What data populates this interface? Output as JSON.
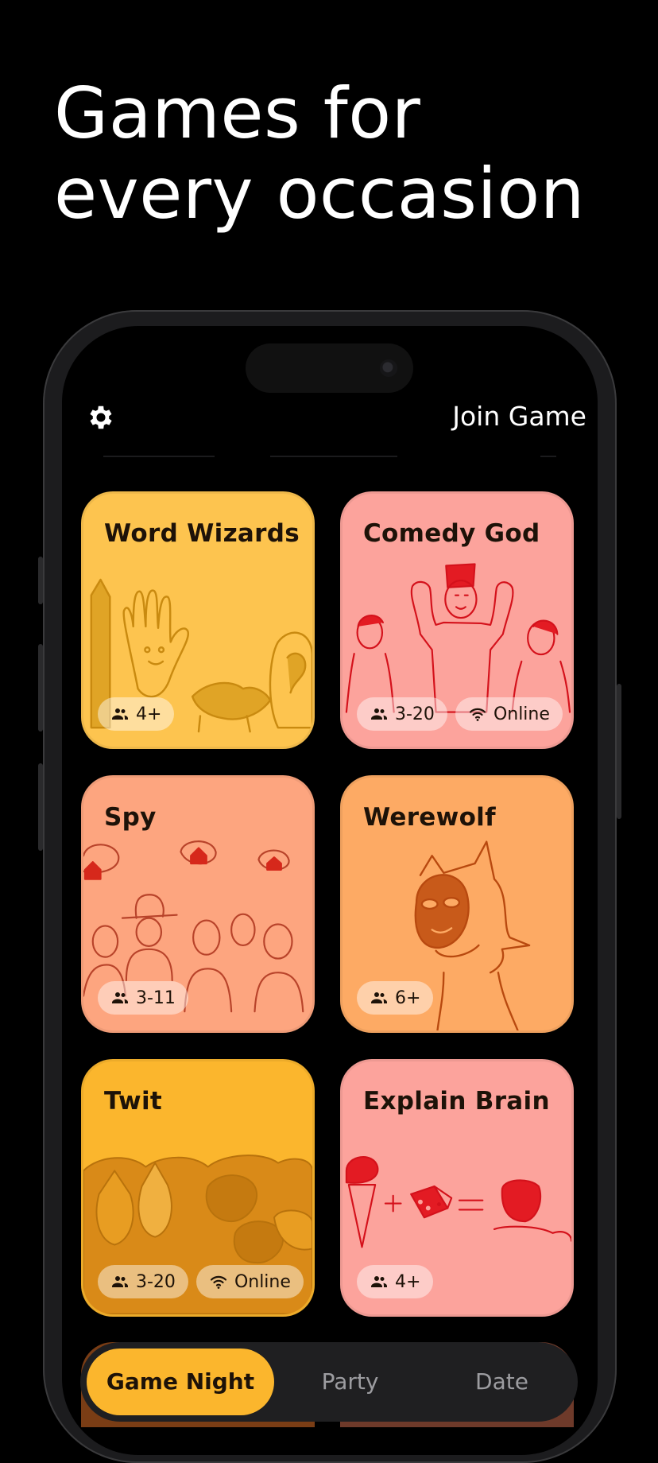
{
  "headline": {
    "line1": "Games for",
    "line2": "every occasion"
  },
  "header": {
    "settings_icon": "gear-icon",
    "join_label": "Join Game"
  },
  "cards": [
    {
      "title": "Word Wizards",
      "color": "#fdc44f",
      "badges": [
        {
          "icon": "people-icon",
          "text": "4+"
        }
      ]
    },
    {
      "title": "Comedy God",
      "color": "#fca39c",
      "badges": [
        {
          "icon": "people-icon",
          "text": "3-20"
        },
        {
          "icon": "wifi-icon",
          "text": "Online"
        }
      ]
    },
    {
      "title": "Spy",
      "color": "#fda57f",
      "badges": [
        {
          "icon": "people-icon",
          "text": "3-11"
        }
      ]
    },
    {
      "title": "Werewolf",
      "color": "#fdaa64",
      "badges": [
        {
          "icon": "people-icon",
          "text": "6+"
        }
      ]
    },
    {
      "title": "Twit",
      "color": "#fbb62d",
      "badges": [
        {
          "icon": "people-icon",
          "text": "3-20"
        },
        {
          "icon": "wifi-icon",
          "text": "Online"
        }
      ]
    },
    {
      "title": "Explain Brain",
      "color": "#fca39c",
      "badges": [
        {
          "icon": "people-icon",
          "text": "4+"
        }
      ]
    }
  ],
  "tabs": [
    {
      "label": "Game Night",
      "active": true
    },
    {
      "label": "Party",
      "active": false
    },
    {
      "label": "Date",
      "active": false
    }
  ]
}
